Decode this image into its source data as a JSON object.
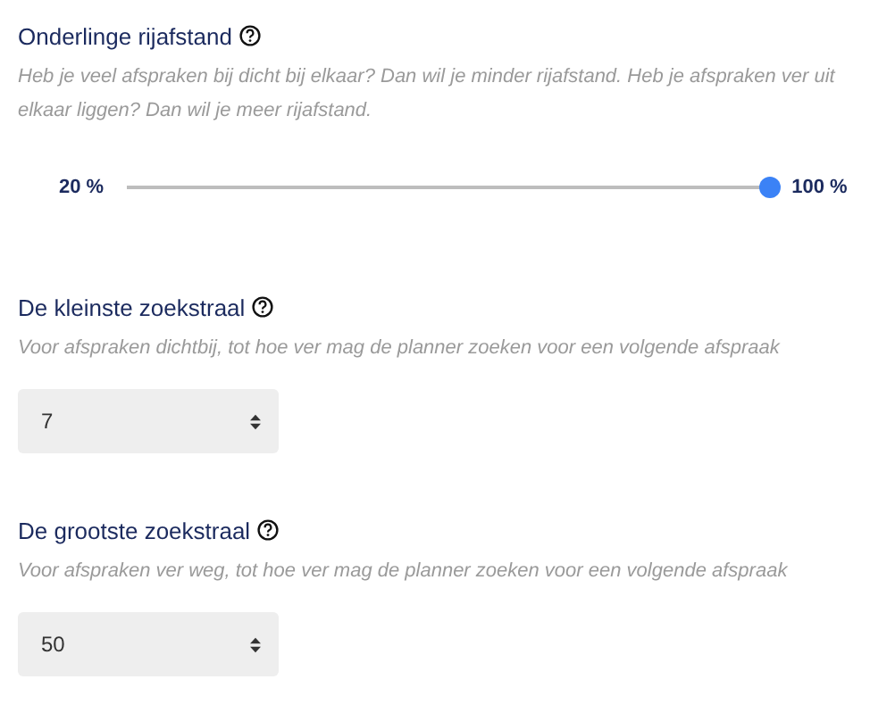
{
  "sections": [
    {
      "kind": "slider",
      "title": "Onderlinge rijafstand",
      "description": "Heb je veel afspraken bij dicht bij elkaar? Dan wil je minder rijafstand. Heb je afspraken ver uit elkaar liggen? Dan wil je meer rijafstand.",
      "min_label": "20 %",
      "max_label": "100 %",
      "level": 1
    },
    {
      "kind": "select",
      "title": "De kleinste zoekstraal",
      "description": "Voor afspraken dichtbij, tot hoe ver mag de planner zoeken voor een volgende afspraak",
      "value": "7"
    },
    {
      "kind": "select",
      "title": "De grootste zoekstraal",
      "description": "Voor afspraken ver weg, tot hoe ver mag de planner zoeken voor een volgende afspraak",
      "value": "50"
    }
  ]
}
